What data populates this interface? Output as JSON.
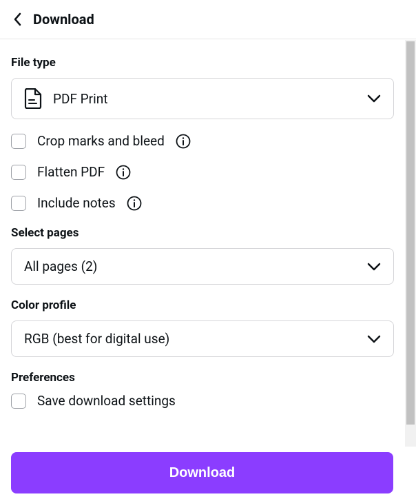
{
  "header": {
    "title": "Download"
  },
  "file_type": {
    "label": "File type",
    "selected": "PDF Print"
  },
  "options": {
    "crop_marks": "Crop marks and bleed",
    "flatten_pdf": "Flatten PDF",
    "include_notes": "Include notes"
  },
  "select_pages": {
    "label": "Select pages",
    "selected": "All pages (2)"
  },
  "color_profile": {
    "label": "Color profile",
    "selected": "RGB (best for digital use)"
  },
  "preferences": {
    "label": "Preferences",
    "save_settings": "Save download settings"
  },
  "download_button": "Download",
  "colors": {
    "primary": "#8b3dff"
  }
}
